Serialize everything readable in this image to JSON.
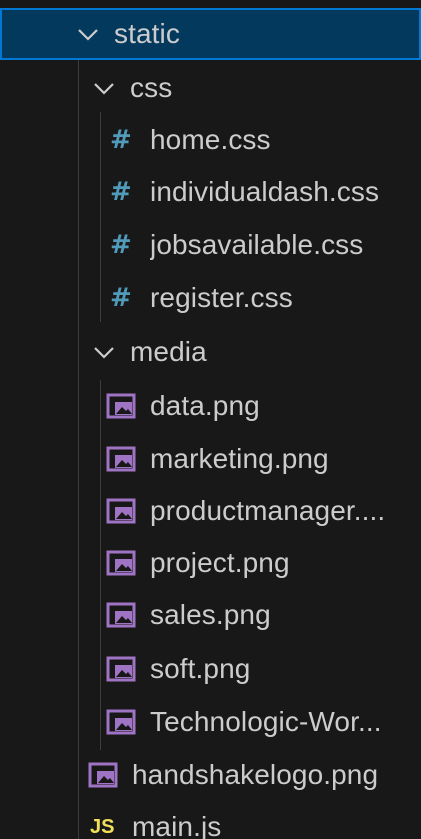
{
  "explorer": {
    "folders": {
      "static": "static",
      "css": "css",
      "media": "media"
    },
    "icons": {
      "chevron": "chevron-down-icon",
      "css_file": "hash-icon",
      "image_file": "image-icon",
      "js_file": "js-icon"
    },
    "icon_glyphs": {
      "css": "#",
      "js": "JS"
    },
    "css_files": [
      "home.css",
      "individualdash.css",
      "jobsavailable.css",
      "register.css"
    ],
    "media_files": [
      "data.png",
      "marketing.png",
      "productmanager....",
      "project.png",
      "sales.png",
      "soft.png",
      "Technologic-Wor..."
    ],
    "root_files": {
      "handshake": "handshakelogo.png",
      "mainjs": "main.js"
    },
    "colors": {
      "selected_bg": "#04395e",
      "selected_border": "#0078d4",
      "css_icon": "#519aba",
      "image_icon": "#a074c4",
      "js_icon": "#f1e05a"
    }
  }
}
